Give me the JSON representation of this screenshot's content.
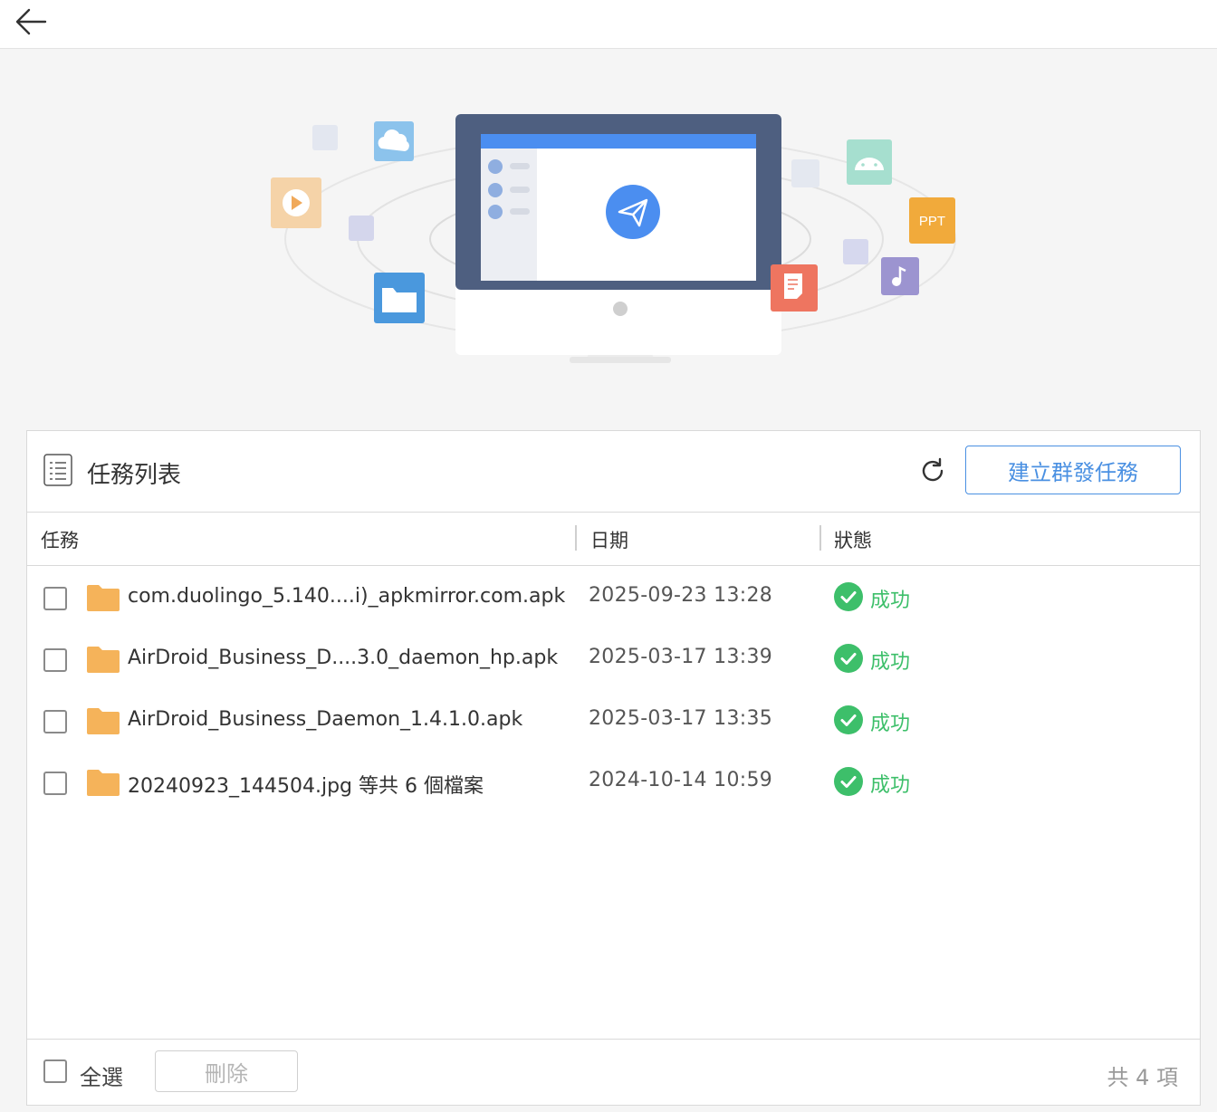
{
  "header": {
    "back_icon": "arrow-left-icon"
  },
  "hero": {
    "ppt_label": "PPT",
    "icons": [
      "cloud-icon",
      "video-icon",
      "folder-icon",
      "android-icon",
      "ppt-icon",
      "music-icon",
      "document-icon",
      "send-icon"
    ]
  },
  "panel": {
    "title": "任務列表",
    "create_button": "建立群發任務",
    "columns": {
      "task": "任務",
      "date": "日期",
      "status": "狀態"
    },
    "rows": [
      {
        "name": "com.duolingo_5.140....i)_apkmirror.com.apk",
        "date": "2025-09-23 13:28",
        "status": "成功"
      },
      {
        "name": "AirDroid_Business_D....3.0_daemon_hp.apk",
        "date": "2025-03-17 13:39",
        "status": "成功"
      },
      {
        "name": "AirDroid_Business_Daemon_1.4.1.0.apk",
        "date": "2025-03-17 13:35",
        "status": "成功"
      },
      {
        "name": "20240923_144504.jpg 等共 6 個檔案",
        "date": "2024-10-14 10:59",
        "status": "成功"
      }
    ],
    "footer": {
      "select_all": "全選",
      "delete": "刪除",
      "count": "共 4 項"
    }
  },
  "colors": {
    "accent": "#4a90e2",
    "success": "#3dbf6a",
    "folder": "#f5b35a"
  }
}
